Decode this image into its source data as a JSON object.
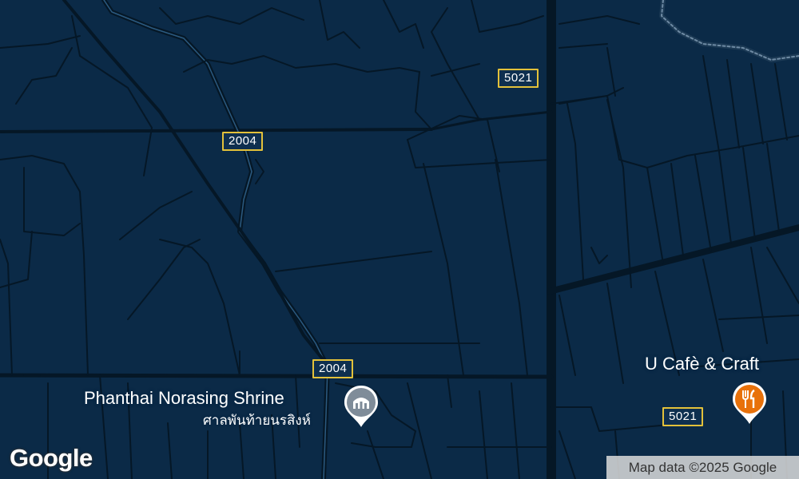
{
  "map": {
    "colors": {
      "land": "#0b2a47",
      "road": "#051726",
      "highway": "#071a2b",
      "shield_border": "#e3c13a",
      "water_line": "#6e8aa3"
    },
    "road_shields": [
      {
        "id": "2004-top",
        "label": "2004"
      },
      {
        "id": "2004-bottom",
        "label": "2004"
      },
      {
        "id": "5021-top",
        "label": "5021"
      },
      {
        "id": "5021-bottom",
        "label": "5021"
      }
    ],
    "pois": [
      {
        "id": "shrine",
        "name": "Phanthai Norasing Shrine",
        "subname": "ศาลพันท้ายนรสิงห์",
        "icon": "shrine-icon",
        "color": "#7f8c99"
      },
      {
        "id": "cafe",
        "name": "U Cafè & Craft",
        "icon": "restaurant-icon",
        "color": "#e8710a"
      }
    ],
    "logo": "Google",
    "attribution": "Map data ©2025 Google"
  }
}
